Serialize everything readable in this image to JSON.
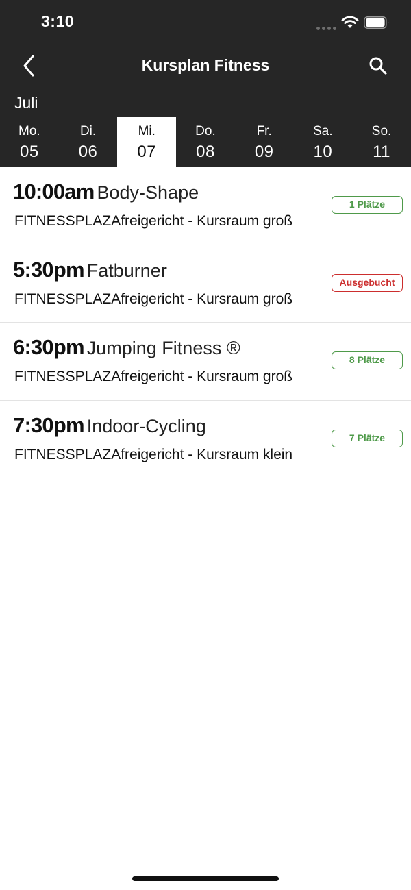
{
  "status_bar": {
    "time": "3:10"
  },
  "nav": {
    "title": "Kursplan Fitness",
    "back_icon": "chevron-left-icon",
    "search_icon": "magnifier-icon"
  },
  "calendar": {
    "month": "Juli",
    "selected_index": 2,
    "days": [
      {
        "name": "Mo.",
        "num": "05"
      },
      {
        "name": "Di.",
        "num": "06"
      },
      {
        "name": "Mi.",
        "num": "07"
      },
      {
        "name": "Do.",
        "num": "08"
      },
      {
        "name": "Fr.",
        "num": "09"
      },
      {
        "name": "Sa.",
        "num": "10"
      },
      {
        "name": "So.",
        "num": "11"
      }
    ]
  },
  "courses": [
    {
      "time": "10:00am",
      "name": "Body-Shape",
      "location": "FITNESSPLAZAfreigericht - Kursraum groß",
      "badge": "1 Plätze",
      "status": "available"
    },
    {
      "time": "5:30pm",
      "name": "Fatburner",
      "location": "FITNESSPLAZAfreigericht - Kursraum groß",
      "badge": "Ausgebucht",
      "status": "full"
    },
    {
      "time": "6:30pm",
      "name": "Jumping Fitness ®",
      "location": "FITNESSPLAZAfreigericht - Kursraum groß",
      "badge": "8 Plätze",
      "status": "available"
    },
    {
      "time": "7:30pm",
      "name": "Indoor-Cycling",
      "location": "FITNESSPLAZAfreigericht - Kursraum klein",
      "badge": "7 Plätze",
      "status": "available"
    }
  ],
  "colors": {
    "header_bg": "#262626",
    "available": "#4f9a4a",
    "full": "#cc2e2e"
  }
}
